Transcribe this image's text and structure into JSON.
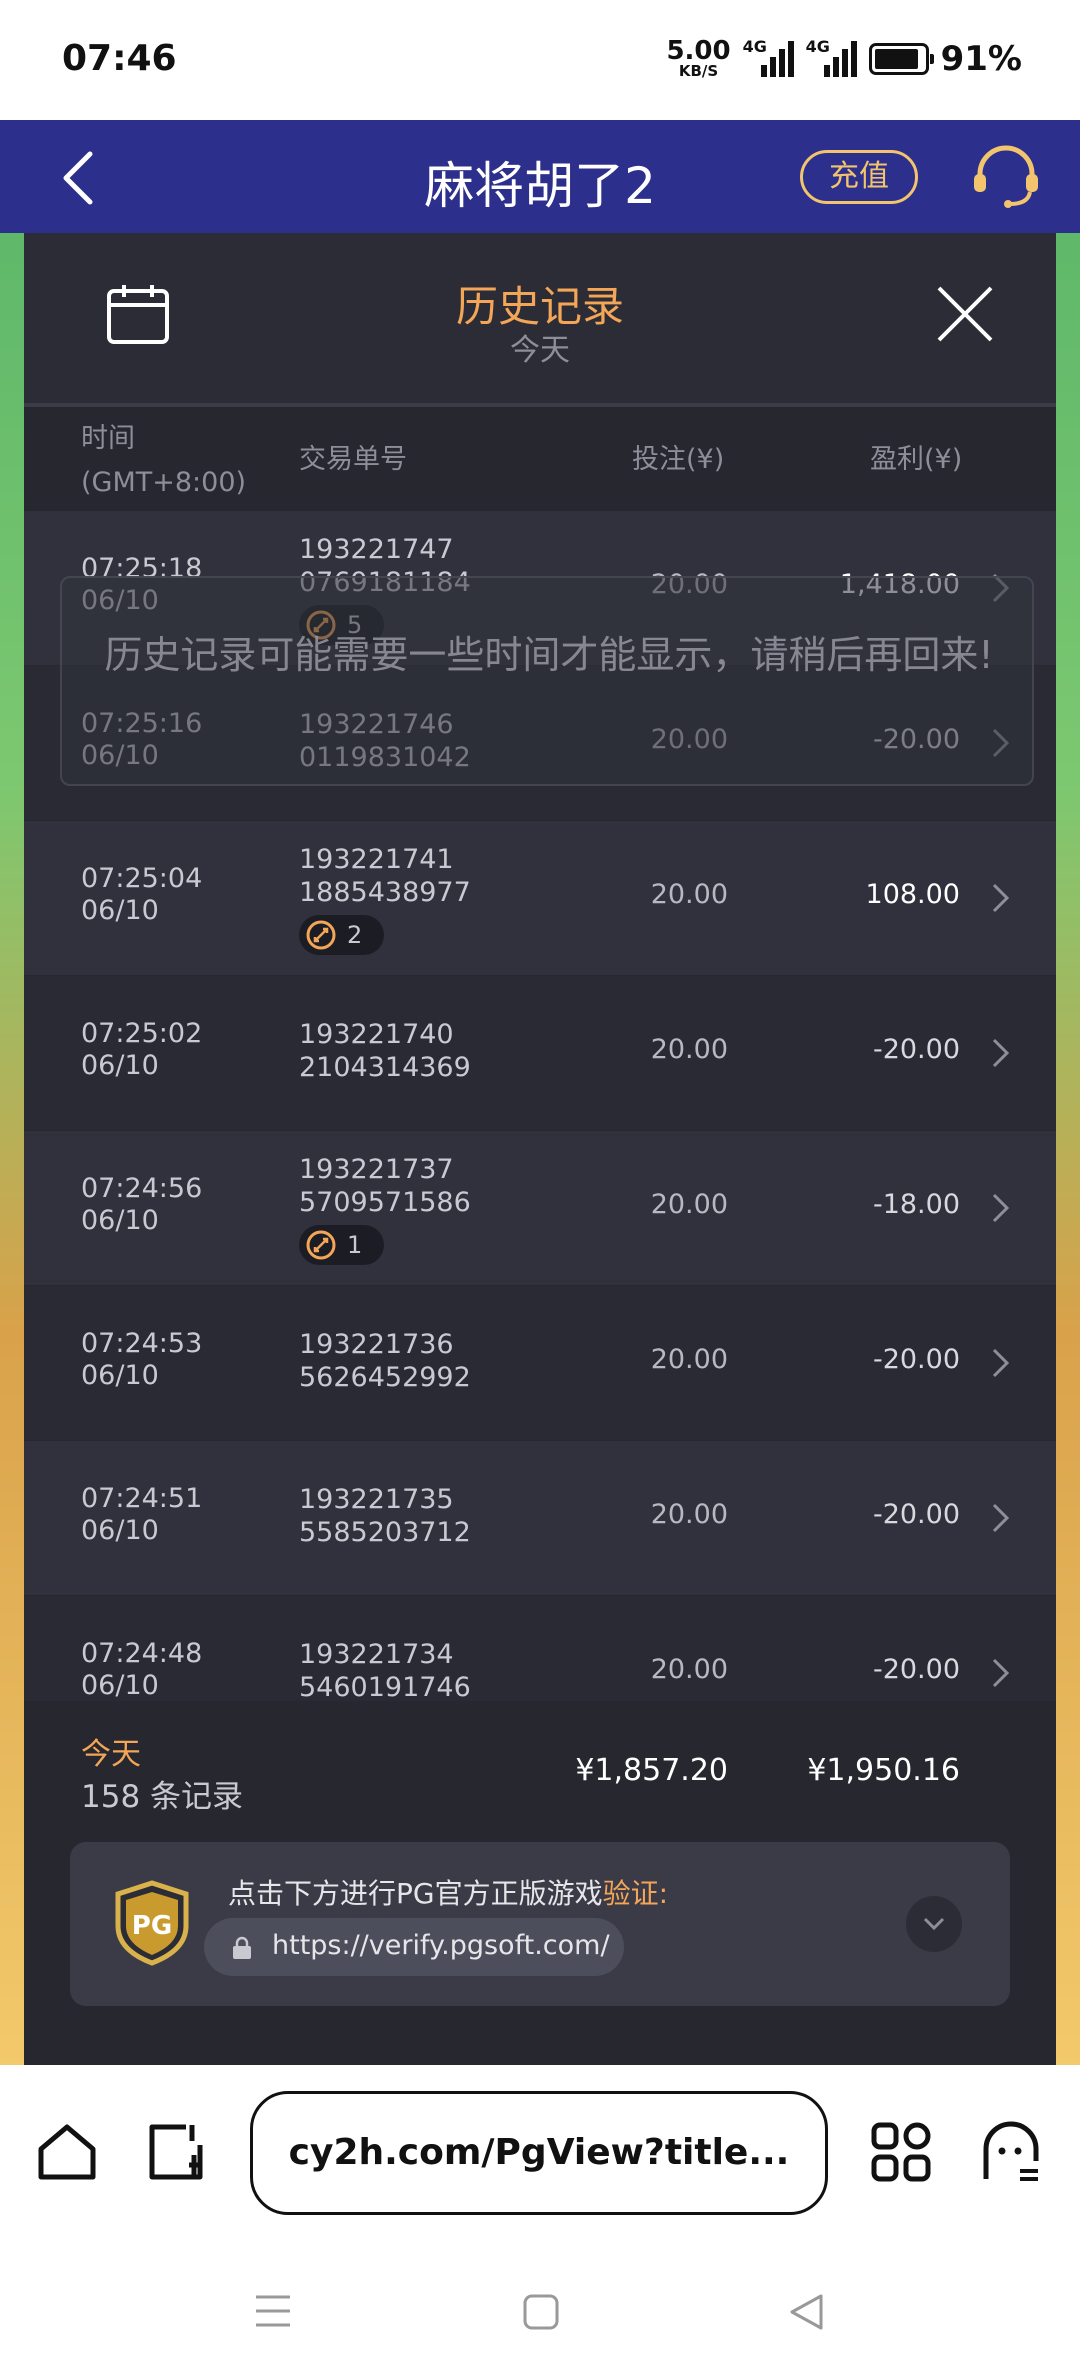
{
  "status_bar": {
    "time": "07:46",
    "net_speed": "5.00",
    "net_unit": "KB/S",
    "signal_1": "4G",
    "signal_2": "4G",
    "battery": "91%"
  },
  "header": {
    "title": "麻将胡了2",
    "recharge": "充值"
  },
  "panel": {
    "title": "历史记录",
    "subtitle": "今天",
    "columns": {
      "time_line1": "时间",
      "time_line2": "(GMT+8:00)",
      "order": "交易单号",
      "bet": "投注(¥)",
      "profit": "盈利(¥)"
    },
    "rows": [
      {
        "time": "07:25:18",
        "date": "06/10",
        "order1": "193221747",
        "order2": "0769181184",
        "badge": "5",
        "bet": "20.00",
        "profit": "1,418.00",
        "positive": true
      },
      {
        "time": "07:25:16",
        "date": "06/10",
        "order1": "193221746",
        "order2": "0119831042",
        "badge": null,
        "bet": "20.00",
        "profit": "-20.00",
        "positive": false
      },
      {
        "time": "07:25:04",
        "date": "06/10",
        "order1": "193221741",
        "order2": "1885438977",
        "badge": "2",
        "bet": "20.00",
        "profit": "108.00",
        "positive": true
      },
      {
        "time": "07:25:02",
        "date": "06/10",
        "order1": "193221740",
        "order2": "2104314369",
        "badge": null,
        "bet": "20.00",
        "profit": "-20.00",
        "positive": false
      },
      {
        "time": "07:24:56",
        "date": "06/10",
        "order1": "193221737",
        "order2": "5709571586",
        "badge": "1",
        "bet": "20.00",
        "profit": "-18.00",
        "positive": false
      },
      {
        "time": "07:24:53",
        "date": "06/10",
        "order1": "193221736",
        "order2": "5626452992",
        "badge": null,
        "bet": "20.00",
        "profit": "-20.00",
        "positive": false
      },
      {
        "time": "07:24:51",
        "date": "06/10",
        "order1": "193221735",
        "order2": "5585203712",
        "badge": null,
        "bet": "20.00",
        "profit": "-20.00",
        "positive": false
      },
      {
        "time": "07:24:48",
        "date": "06/10",
        "order1": "193221734",
        "order2": "5460191746",
        "badge": null,
        "bet": "20.00",
        "profit": "-20.00",
        "positive": false
      }
    ],
    "toast": "历史记录可能需要一些时间才能显示，请稍后再回来!",
    "summary": {
      "label": "今天",
      "count": "158 条记录",
      "total_bet": "¥1,857.20",
      "total_profit": "¥1,950.16"
    },
    "verify": {
      "text": "点击下方进行PG官方正版游戏",
      "highlight": "验证:",
      "url": "https://verify.pgsoft.com/"
    }
  },
  "browser": {
    "url": "cy2h.com/PgView?title..."
  },
  "colors": {
    "header_bg": "#2c2f8c",
    "accent_orange": "#f3a558",
    "recharge_gold": "#f2c46d",
    "panel_bg": "#26272f"
  }
}
